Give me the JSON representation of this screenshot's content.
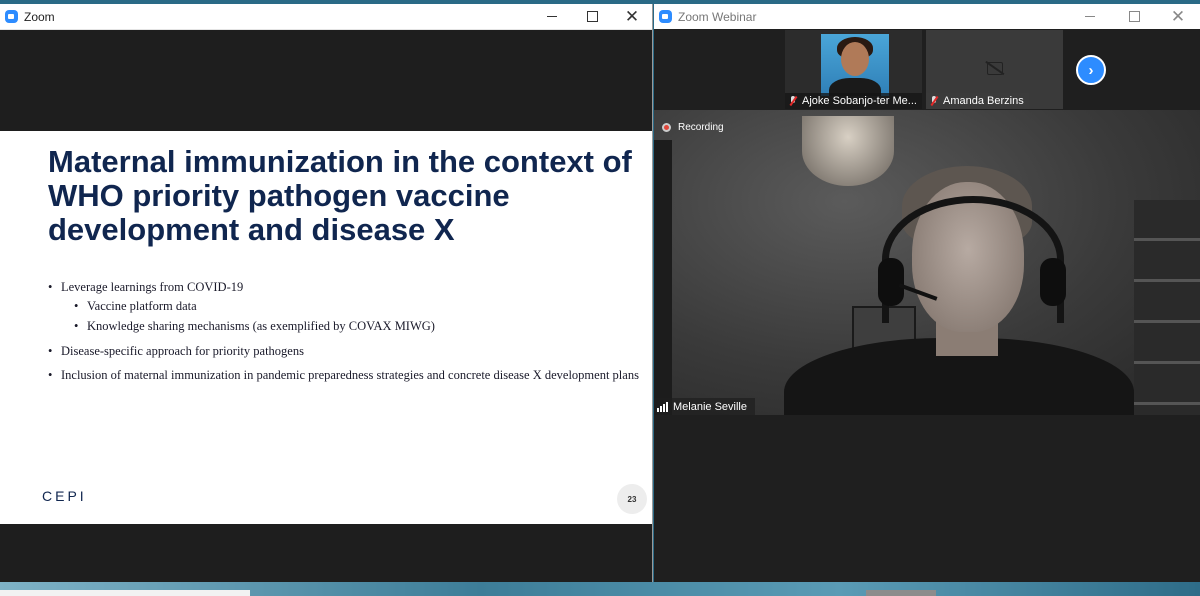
{
  "left_window": {
    "title": "Zoom",
    "slide": {
      "title": "Maternal immunization in the context of WHO priority pathogen vaccine development and disease X",
      "bullets": [
        "Leverage learnings from COVID-19",
        "Vaccine platform data",
        "Knowledge sharing mechanisms (as exemplified by COVAX MIWG)",
        "Disease-specific approach for priority pathogens",
        "Inclusion of maternal immunization in pandemic preparedness strategies and concrete disease X development plans"
      ],
      "logo_text": "CEPI",
      "page_number": "23"
    },
    "controls": {
      "minimize": "—",
      "maximize": "",
      "close": "✕"
    }
  },
  "right_window": {
    "title": "Zoom Webinar",
    "controls": {
      "minimize": "—",
      "maximize": "",
      "close": "✕"
    },
    "participants": [
      {
        "name": "Ajoke Sobanjo-ter Me...",
        "muted": true,
        "video": true
      },
      {
        "name": "Amanda Berzins",
        "muted": true,
        "video": false
      }
    ],
    "next_label": "›",
    "recording_label": "Recording",
    "active_speaker": "Melanie Seville"
  },
  "colors": {
    "slide_title": "#10264f",
    "zoom_blue": "#2d8cff",
    "recording_red": "#e0463a",
    "muted_red": "#e02828"
  }
}
